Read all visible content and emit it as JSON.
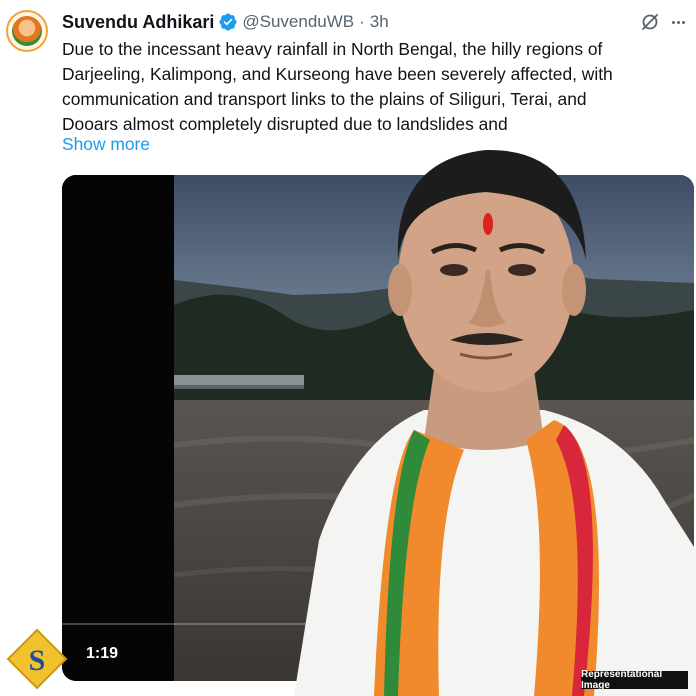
{
  "author": {
    "display_name": "Suvendu Adhikari",
    "handle": "@SuvenduWB",
    "separator": "·",
    "time": "3h",
    "avatar_icon": "party-emblem-avatar",
    "verified_icon": "verified-badge-icon",
    "verified_color": "#1d9bf0"
  },
  "actions": {
    "grok_icon": "grok-icon",
    "more_icon": "more-options-icon"
  },
  "tweet": {
    "lines": [
      "Due to the incessant heavy rainfall in North Bengal, the hilly regions of",
      "Darjeeling, Kalimpong, and Kurseong have been severely affected, with",
      "communication and transport links to the plains of Siliguri, Terai, and",
      "Dooars almost completely disrupted due to landslides and"
    ],
    "show_more": "Show more",
    "link_color": "#1d9bf0"
  },
  "media": {
    "duration": "1:19",
    "content": "flood-video-thumbnail"
  },
  "overlay": {
    "caption": "Representational Image",
    "watermark": "snewz-logo"
  }
}
